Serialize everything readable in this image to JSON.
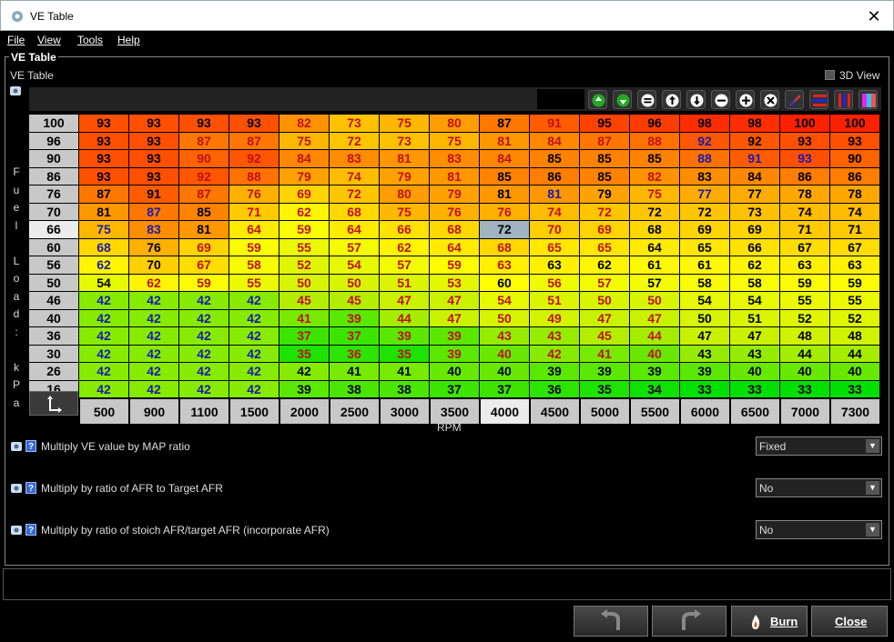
{
  "window": {
    "title": "VE Table",
    "close_glyph": "✕",
    "icon": "app-icon"
  },
  "menu": {
    "items": [
      "File",
      "View",
      "Tools",
      "Help"
    ]
  },
  "panel": {
    "legend": "VE Table",
    "subtitle": "VE Table",
    "view3d_label": "3D View",
    "view3d_checked": false
  },
  "toolbar": {
    "buttons": [
      "increment-icon",
      "decrement-icon",
      "set-equal-icon",
      "scale-up-icon",
      "scale-down-icon",
      "subtract-icon",
      "add-icon",
      "multiply-icon",
      "interpolate-icon",
      "horizontal-smooth-icon",
      "vertical-smooth-icon",
      "color-map-icon"
    ]
  },
  "axes": {
    "y_label": "Fuel Load: kPa",
    "x_label": "RPM",
    "y_values": [
      "100",
      "96",
      "90",
      "86",
      "76",
      "70",
      "66",
      "60",
      "56",
      "50",
      "46",
      "40",
      "36",
      "30",
      "26",
      "16"
    ],
    "x_values": [
      "500",
      "900",
      "1100",
      "1500",
      "2000",
      "2500",
      "3000",
      "3500",
      "4000",
      "4500",
      "5000",
      "5500",
      "6000",
      "6500",
      "7000",
      "7300"
    ],
    "highlight_row": 6,
    "highlight_col": 8
  },
  "table": {
    "values": [
      [
        "93",
        "93",
        "93",
        "93",
        "82",
        "73",
        "75",
        "80",
        "87",
        "91",
        "95",
        "96",
        "98",
        "98",
        "100",
        "100"
      ],
      [
        "93",
        "93",
        "87",
        "87",
        "75",
        "72",
        "73",
        "75",
        "81",
        "84",
        "87",
        "88",
        "92",
        "92",
        "93",
        "93"
      ],
      [
        "93",
        "93",
        "90",
        "92",
        "84",
        "83",
        "81",
        "83",
        "84",
        "85",
        "85",
        "85",
        "88",
        "91",
        "93",
        "90"
      ],
      [
        "93",
        "93",
        "92",
        "88",
        "79",
        "74",
        "79",
        "81",
        "85",
        "86",
        "85",
        "82",
        "83",
        "84",
        "86",
        "86"
      ],
      [
        "87",
        "91",
        "87",
        "76",
        "69",
        "72",
        "80",
        "79",
        "81",
        "81",
        "79",
        "75",
        "77",
        "77",
        "78",
        "78"
      ],
      [
        "81",
        "87",
        "85",
        "71",
        "62",
        "68",
        "75",
        "76",
        "76",
        "74",
        "72",
        "72",
        "72",
        "73",
        "74",
        "74"
      ],
      [
        "75",
        "83",
        "81",
        "64",
        "59",
        "64",
        "66",
        "68",
        "72",
        "70",
        "69",
        "68",
        "69",
        "69",
        "71",
        "71"
      ],
      [
        "68",
        "76",
        "69",
        "59",
        "55",
        "57",
        "62",
        "64",
        "68",
        "65",
        "65",
        "64",
        "65",
        "66",
        "67",
        "67"
      ],
      [
        "62",
        "70",
        "67",
        "58",
        "52",
        "54",
        "57",
        "59",
        "63",
        "63",
        "62",
        "61",
        "61",
        "62",
        "63",
        "63"
      ],
      [
        "54",
        "62",
        "59",
        "55",
        "50",
        "50",
        "51",
        "53",
        "60",
        "56",
        "57",
        "57",
        "58",
        "58",
        "59",
        "59"
      ],
      [
        "42",
        "42",
        "42",
        "42",
        "45",
        "45",
        "47",
        "47",
        "54",
        "51",
        "50",
        "50",
        "54",
        "54",
        "55",
        "55"
      ],
      [
        "42",
        "42",
        "42",
        "42",
        "41",
        "39",
        "44",
        "47",
        "50",
        "49",
        "47",
        "47",
        "50",
        "51",
        "52",
        "52"
      ],
      [
        "42",
        "42",
        "42",
        "42",
        "37",
        "37",
        "39",
        "39",
        "43",
        "43",
        "45",
        "44",
        "47",
        "47",
        "48",
        "48"
      ],
      [
        "42",
        "42",
        "42",
        "42",
        "35",
        "36",
        "35",
        "39",
        "40",
        "42",
        "41",
        "40",
        "43",
        "43",
        "44",
        "44"
      ],
      [
        "42",
        "42",
        "42",
        "42",
        "42",
        "41",
        "41",
        "40",
        "40",
        "39",
        "39",
        "39",
        "39",
        "40",
        "40",
        "40"
      ],
      [
        "42",
        "42",
        "42",
        "42",
        "39",
        "38",
        "38",
        "37",
        "37",
        "36",
        "35",
        "34",
        "33",
        "33",
        "33",
        "33"
      ]
    ],
    "text_colors": [
      [
        "b",
        "b",
        "b",
        "b",
        "r",
        "r",
        "r",
        "r",
        "b",
        "r",
        "b",
        "b",
        "b",
        "b",
        "b",
        "b"
      ],
      [
        "b",
        "b",
        "r",
        "r",
        "r",
        "r",
        "r",
        "r",
        "r",
        "r",
        "r",
        "r",
        "u",
        "b",
        "b",
        "b"
      ],
      [
        "b",
        "b",
        "r",
        "r",
        "r",
        "r",
        "r",
        "r",
        "r",
        "b",
        "b",
        "b",
        "u",
        "u",
        "u",
        "b"
      ],
      [
        "b",
        "b",
        "r",
        "r",
        "r",
        "r",
        "r",
        "r",
        "b",
        "b",
        "b",
        "r",
        "b",
        "b",
        "b",
        "b"
      ],
      [
        "b",
        "b",
        "r",
        "r",
        "r",
        "r",
        "r",
        "r",
        "b",
        "u",
        "b",
        "r",
        "u",
        "b",
        "b",
        "b"
      ],
      [
        "b",
        "u",
        "b",
        "r",
        "r",
        "r",
        "r",
        "r",
        "r",
        "r",
        "r",
        "b",
        "b",
        "b",
        "b",
        "b"
      ],
      [
        "u",
        "u",
        "b",
        "r",
        "r",
        "r",
        "r",
        "r",
        "b",
        "r",
        "r",
        "b",
        "b",
        "b",
        "b",
        "b"
      ],
      [
        "u",
        "b",
        "r",
        "r",
        "r",
        "r",
        "r",
        "r",
        "r",
        "r",
        "r",
        "b",
        "b",
        "b",
        "b",
        "b"
      ],
      [
        "u",
        "b",
        "r",
        "r",
        "r",
        "r",
        "r",
        "r",
        "r",
        "b",
        "b",
        "b",
        "b",
        "b",
        "b",
        "b"
      ],
      [
        "b",
        "r",
        "r",
        "r",
        "r",
        "r",
        "r",
        "r",
        "b",
        "r",
        "r",
        "b",
        "b",
        "b",
        "b",
        "b"
      ],
      [
        "u",
        "u",
        "u",
        "u",
        "r",
        "r",
        "r",
        "r",
        "r",
        "r",
        "r",
        "r",
        "b",
        "b",
        "b",
        "b"
      ],
      [
        "u",
        "u",
        "u",
        "u",
        "r",
        "r",
        "r",
        "r",
        "r",
        "r",
        "r",
        "r",
        "b",
        "b",
        "b",
        "b"
      ],
      [
        "u",
        "u",
        "u",
        "u",
        "r",
        "r",
        "r",
        "r",
        "r",
        "r",
        "r",
        "r",
        "b",
        "b",
        "b",
        "b"
      ],
      [
        "u",
        "u",
        "u",
        "u",
        "r",
        "r",
        "r",
        "r",
        "r",
        "r",
        "r",
        "r",
        "b",
        "b",
        "b",
        "b"
      ],
      [
        "u",
        "u",
        "u",
        "u",
        "b",
        "b",
        "b",
        "b",
        "b",
        "b",
        "b",
        "b",
        "b",
        "b",
        "b",
        "b"
      ],
      [
        "u",
        "u",
        "u",
        "u",
        "b",
        "b",
        "b",
        "b",
        "b",
        "b",
        "b",
        "b",
        "b",
        "b",
        "b",
        "b"
      ]
    ],
    "color_key": {
      "b": "#000000",
      "r": "#c0101a",
      "u": "#1a1ab0"
    },
    "heat_colors": {
      "min_value": 33,
      "max_value": 100,
      "stops": [
        "#00e000",
        "#c8f000",
        "#ffff00",
        "#ffc000",
        "#ff7a00",
        "#ff2000"
      ],
      "selected_cell": "#9fb4c0"
    }
  },
  "options": [
    {
      "label": "Multiply VE value by MAP ratio",
      "value": "Fixed"
    },
    {
      "label": "Multiply by ratio of AFR to Target AFR",
      "value": "No"
    },
    {
      "label": "Multiply by ratio of stoich AFR/target AFR (incorporate AFR)",
      "value": "No"
    }
  ],
  "buttons": {
    "undo_icon": "undo-icon",
    "redo_icon": "redo-icon",
    "burn": "Burn",
    "close": "Close",
    "burn_icon": "flame-icon"
  }
}
